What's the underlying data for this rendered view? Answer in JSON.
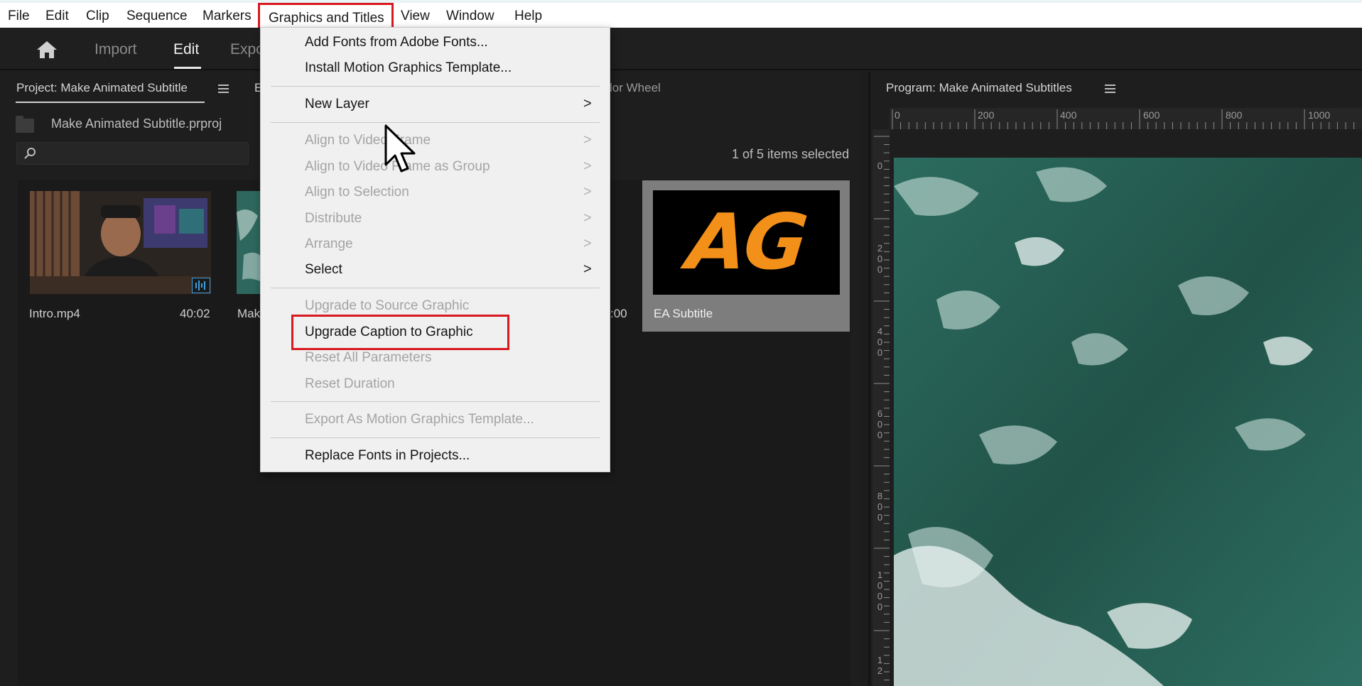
{
  "menubar": {
    "items": [
      "File",
      "Edit",
      "Clip",
      "Sequence",
      "Markers",
      "Graphics and Titles",
      "View",
      "Window",
      "Help"
    ],
    "active_index": 5
  },
  "header": {
    "tabs": [
      "Import",
      "Edit",
      "Expo"
    ],
    "active_tab": "Edit"
  },
  "project_panel": {
    "tab_label": "Project: Make Animated Subtitle",
    "second_tab_partial": "E",
    "third_tab_partial": "lor Wheel",
    "project_file": "Make Animated Subtitle.prproj",
    "search_placeholder": "",
    "items_selected": "1 of 5 items selected",
    "items": [
      {
        "name": "Intro.mp4",
        "duration": "40:02"
      },
      {
        "name": "Mak",
        "duration": ""
      },
      {
        "name": "",
        "duration": ":00"
      },
      {
        "name": "EA Subtitle",
        "duration": "",
        "thumbnail_text": "AG",
        "selected": true
      }
    ]
  },
  "program_panel": {
    "title": "Program: Make Animated Subtitles",
    "ruler_top": [
      "0",
      "200",
      "400",
      "600",
      "800",
      "1000"
    ],
    "ruler_left": [
      "0",
      "200",
      "400",
      "600",
      "800",
      "1000",
      "12"
    ]
  },
  "dropdown": {
    "items": [
      {
        "label": "Add Fonts from Adobe Fonts...",
        "disabled": false,
        "submenu": false
      },
      {
        "label": "Install Motion Graphics Template...",
        "disabled": false,
        "submenu": false
      },
      {
        "label": "New Layer",
        "disabled": false,
        "submenu": true
      },
      {
        "label": "Align to Video Frame",
        "disabled": true,
        "submenu": true
      },
      {
        "label": "Align to Video Frame as Group",
        "disabled": true,
        "submenu": true
      },
      {
        "label": "Align to Selection",
        "disabled": true,
        "submenu": true
      },
      {
        "label": "Distribute",
        "disabled": true,
        "submenu": true
      },
      {
        "label": "Arrange",
        "disabled": true,
        "submenu": true
      },
      {
        "label": "Select",
        "disabled": false,
        "submenu": true
      },
      {
        "label": "Upgrade to Source Graphic",
        "disabled": true,
        "submenu": false
      },
      {
        "label": "Upgrade Caption to Graphic",
        "disabled": false,
        "submenu": false,
        "highlighted": true
      },
      {
        "label": "Reset All Parameters",
        "disabled": true,
        "submenu": false
      },
      {
        "label": "Reset Duration",
        "disabled": true,
        "submenu": false
      },
      {
        "label": "Export As Motion Graphics Template...",
        "disabled": true,
        "submenu": false
      },
      {
        "label": "Replace Fonts in Projects...",
        "disabled": false,
        "submenu": false
      }
    ],
    "chevron_glyph": ">"
  },
  "colors": {
    "highlight_box": "#d71920",
    "menu_bg": "#f0f0f0",
    "panel_bg": "#1e1e1e",
    "thumbnail_text": "#f39019"
  },
  "icons": [
    "home-icon",
    "hamburger-icon",
    "folder-icon",
    "search-icon",
    "chevron-right-icon",
    "mouse-cursor-icon",
    "audio-waveform-icon"
  ]
}
